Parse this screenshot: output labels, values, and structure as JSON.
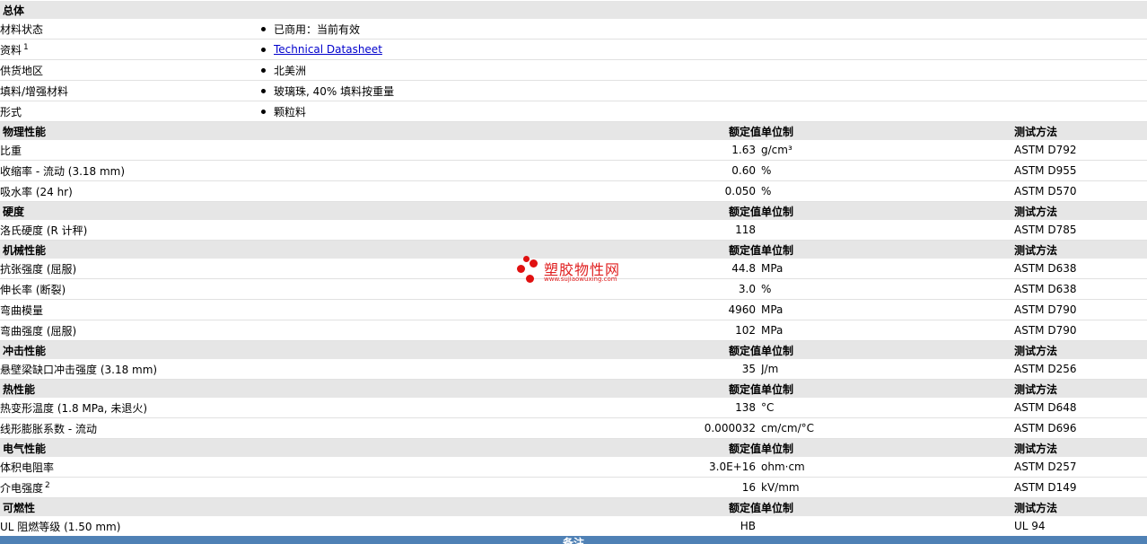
{
  "general": {
    "title": "总体",
    "rows": [
      {
        "label": "材料状态",
        "value": "已商用：当前有效"
      },
      {
        "label": "资料",
        "sup": "1",
        "value": "Technical Datasheet",
        "link": true
      },
      {
        "label": "供货地区",
        "value": "北美洲"
      },
      {
        "label": "填料/增强材料",
        "value": "玻璃珠, 40% 填料按重量"
      },
      {
        "label": "形式",
        "value": "颗粒料"
      }
    ]
  },
  "headers": {
    "nominal": "额定值",
    "unit": "单位制",
    "method": "测试方法"
  },
  "sections": [
    {
      "title": "物理性能",
      "rows": [
        {
          "label": "比重",
          "value": "1.63",
          "unit": "g/cm³",
          "method": "ASTM D792"
        },
        {
          "label": "收缩率 - 流动 (3.18 mm)",
          "value": "0.60",
          "unit": "%",
          "method": "ASTM D955"
        },
        {
          "label": "吸水率 (24 hr)",
          "value": "0.050",
          "unit": "%",
          "method": "ASTM D570"
        }
      ]
    },
    {
      "title": "硬度",
      "rows": [
        {
          "label": "洛氏硬度 (R 计秤)",
          "value": "118",
          "unit": "",
          "method": "ASTM D785"
        }
      ]
    },
    {
      "title": "机械性能",
      "rows": [
        {
          "label": "抗张强度 (屈服)",
          "value": "44.8",
          "unit": "MPa",
          "method": "ASTM D638"
        },
        {
          "label": "伸长率 (断裂)",
          "value": "3.0",
          "unit": "%",
          "method": "ASTM D638"
        },
        {
          "label": "弯曲模量",
          "value": "4960",
          "unit": "MPa",
          "method": "ASTM D790"
        },
        {
          "label": "弯曲强度 (屈服)",
          "value": "102",
          "unit": "MPa",
          "method": "ASTM D790"
        }
      ]
    },
    {
      "title": "冲击性能",
      "rows": [
        {
          "label": "悬壁梁缺口冲击强度 (3.18 mm)",
          "value": "35",
          "unit": "J/m",
          "method": "ASTM D256"
        }
      ]
    },
    {
      "title": "热性能",
      "rows": [
        {
          "label": "热变形温度 (1.8 MPa, 未退火)",
          "value": "138",
          "unit": "°C",
          "method": "ASTM D648"
        },
        {
          "label": "线形膨胀系数 - 流动",
          "value": "0.000032",
          "unit": "cm/cm/°C",
          "method": "ASTM D696"
        }
      ]
    },
    {
      "title": "电气性能",
      "rows": [
        {
          "label": "体积电阻率",
          "value": "3.0E+16",
          "unit": "ohm·cm",
          "method": "ASTM D257"
        },
        {
          "label": "介电强度",
          "sup": "2",
          "value": "16",
          "unit": "kV/mm",
          "method": "ASTM D149"
        }
      ]
    },
    {
      "title": "可燃性",
      "rows": [
        {
          "label": "UL 阻燃等级 (1.50 mm)",
          "value": "HB",
          "unit": "",
          "method": "UL 94"
        }
      ]
    }
  ],
  "footer": {
    "label": "备注"
  },
  "watermark": {
    "name": "塑胶物性网",
    "url": "www.sujiaowuxing.com"
  },
  "colors": {
    "section_bg": "#e6e6e6",
    "footer_bg": "#4f81b5",
    "link": "#0000cc",
    "watermark": "#e01010"
  }
}
